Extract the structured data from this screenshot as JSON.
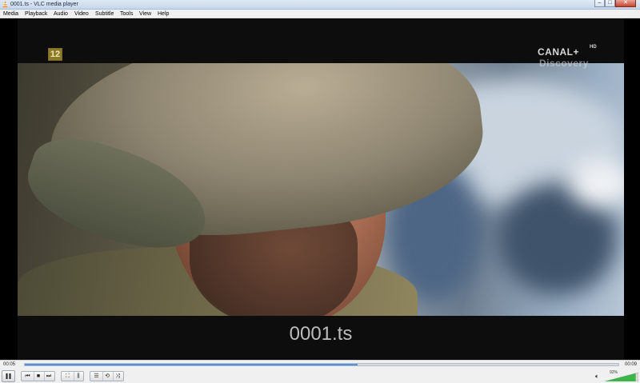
{
  "window": {
    "title": "0001.ts - VLC media player",
    "minimize_label": "–",
    "maximize_label": "□",
    "close_label": "✕"
  },
  "menu": {
    "items": [
      "Media",
      "Playback",
      "Audio",
      "Video",
      "Subtitle",
      "Tools",
      "View",
      "Help"
    ]
  },
  "video": {
    "age_rating": "12",
    "channel_logo_main": "CANAL+",
    "channel_logo_hd": "HD",
    "channel_logo_sub": "Discovery",
    "file_title": "0001.ts"
  },
  "playback": {
    "elapsed": "00:05",
    "total": "00:09",
    "progress_fraction": 0.56
  },
  "volume": {
    "percent_label": "92%",
    "level_fraction": 0.92
  },
  "icons": {
    "app": "vlc-cone-icon",
    "pause": "pause-icon",
    "previous": "previous-icon",
    "stop": "stop-icon",
    "next": "next-icon",
    "fullscreen": "fullscreen-icon",
    "extended": "extended-settings-icon",
    "playlist": "playlist-icon",
    "loop": "loop-icon",
    "shuffle": "shuffle-icon",
    "speaker": "speaker-icon"
  },
  "colors": {
    "accent": "#2f78cf",
    "volume_fill": "#39b54a"
  }
}
